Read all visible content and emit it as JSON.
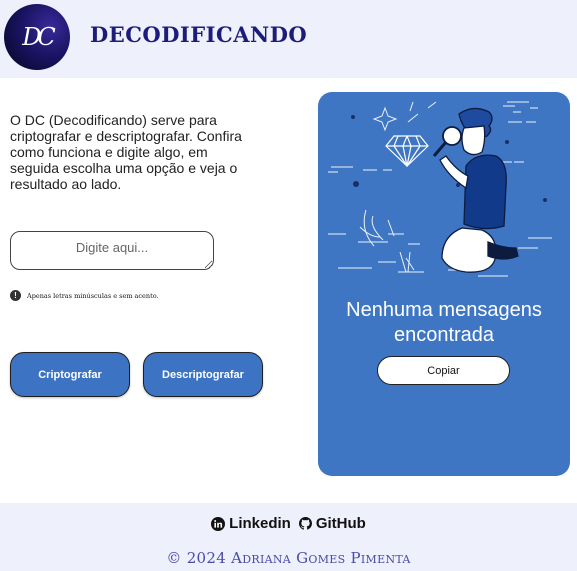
{
  "header": {
    "logo_text": "DC",
    "brand": "DECODIFICANDO"
  },
  "main": {
    "intro": "O DC (Decodificando) serve para criptografar e descriptografar. Confira como funciona e digite algo, em seguida escolha uma opção e veja o resultado ao lado.",
    "input_placeholder": "Digite aqui...",
    "warning": "Apenas letras minúsculas e sem acento.",
    "encrypt_label": "Criptografar",
    "decrypt_label": "Descriptografar"
  },
  "panel": {
    "message": "Nenhuma mensagens encontrada",
    "copy_label": "Copiar"
  },
  "footer": {
    "linkedin": "Linkedin",
    "github": "GitHub",
    "copyright": "© 2024 Adriana Gomes Pimenta"
  },
  "colors": {
    "accent": "#3c73c2",
    "panel": "#3e76c4",
    "header_bg": "#eef0fb",
    "brand": "#1c1c7a"
  }
}
